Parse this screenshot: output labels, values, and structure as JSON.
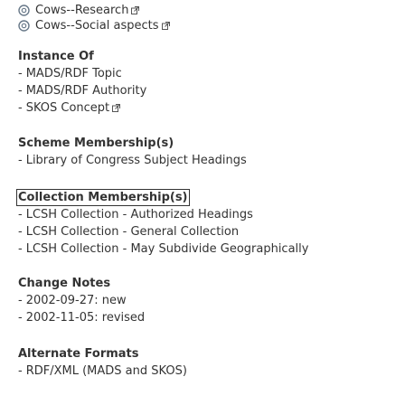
{
  "related_links": [
    {
      "label": "Cows--Research",
      "icon": "concept-icon"
    },
    {
      "label": "Cows--Social aspects",
      "icon": "concept-icon"
    }
  ],
  "instance_of": {
    "title": "Instance Of",
    "items": [
      {
        "label": "MADS/RDF Topic"
      },
      {
        "label": "MADS/RDF Authority"
      },
      {
        "label": "SKOS Concept"
      }
    ]
  },
  "scheme_membership": {
    "title": "Scheme Membership(s)",
    "items": [
      {
        "label": "Library of Congress Subject Headings"
      }
    ]
  },
  "collection_membership": {
    "title": "Collection Membership(s)",
    "items": [
      {
        "label": "LCSH Collection - Authorized Headings"
      },
      {
        "label": "LCSH Collection - General Collection"
      },
      {
        "label": "LCSH Collection - May Subdivide Geographically"
      }
    ]
  },
  "change_notes": {
    "title": "Change Notes",
    "items": [
      {
        "label": "2002-09-27: new"
      },
      {
        "label": "2002-11-05: revised"
      }
    ]
  },
  "alternate_formats": {
    "title": "Alternate Formats",
    "items": [
      {
        "label": "RDF/XML (MADS and SKOS)"
      }
    ]
  },
  "colors": {
    "text": "#333333",
    "icon_ring": "#6a7a8a"
  }
}
